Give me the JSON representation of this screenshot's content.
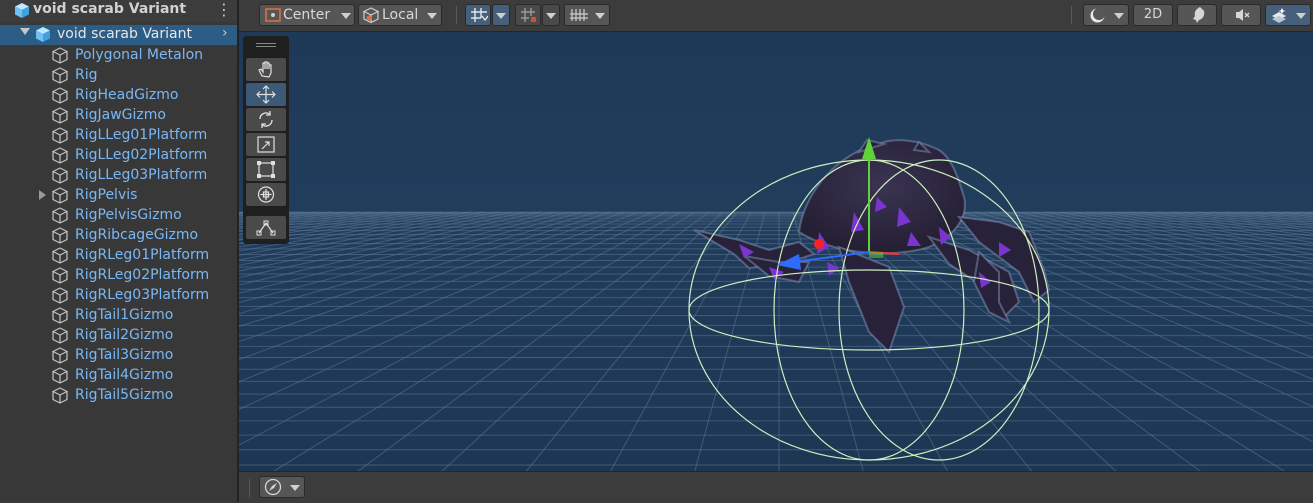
{
  "hierarchy": {
    "title": "void scarab Variant",
    "menu_icon": "kebab-menu-icon",
    "root": {
      "label": "void scarab Variant",
      "icon": "prefab-cube-icon"
    },
    "items": [
      {
        "label": "Polygonal Metalon",
        "has_children": false
      },
      {
        "label": "Rig",
        "has_children": false
      },
      {
        "label": "RigHeadGizmo",
        "has_children": false
      },
      {
        "label": "RigJawGizmo",
        "has_children": false
      },
      {
        "label": "RigLLeg01Platform",
        "has_children": false
      },
      {
        "label": "RigLLeg02Platform",
        "has_children": false
      },
      {
        "label": "RigLLeg03Platform",
        "has_children": false
      },
      {
        "label": "RigPelvis",
        "has_children": true
      },
      {
        "label": "RigPelvisGizmo",
        "has_children": false
      },
      {
        "label": "RigRibcageGizmo",
        "has_children": false
      },
      {
        "label": "RigRLeg01Platform",
        "has_children": false
      },
      {
        "label": "RigRLeg02Platform",
        "has_children": false
      },
      {
        "label": "RigRLeg03Platform",
        "has_children": false
      },
      {
        "label": "RigTail1Gizmo",
        "has_children": false
      },
      {
        "label": "RigTail2Gizmo",
        "has_children": false
      },
      {
        "label": "RigTail3Gizmo",
        "has_children": false
      },
      {
        "label": "RigTail4Gizmo",
        "has_children": false
      },
      {
        "label": "RigTail5Gizmo",
        "has_children": false
      }
    ]
  },
  "toolbar": {
    "pivot_label": "Center",
    "space_label": "Local",
    "mode_2d_label": "2D"
  },
  "colors": {
    "selection": "#2c5d87",
    "hierarchy_child_text": "#7ab8f5",
    "scene_bg": "#213a57",
    "gizmo_x": "#ff2020",
    "gizmo_y": "#5ed33a",
    "gizmo_z": "#2f6bff",
    "collider": "#cfeec0"
  }
}
